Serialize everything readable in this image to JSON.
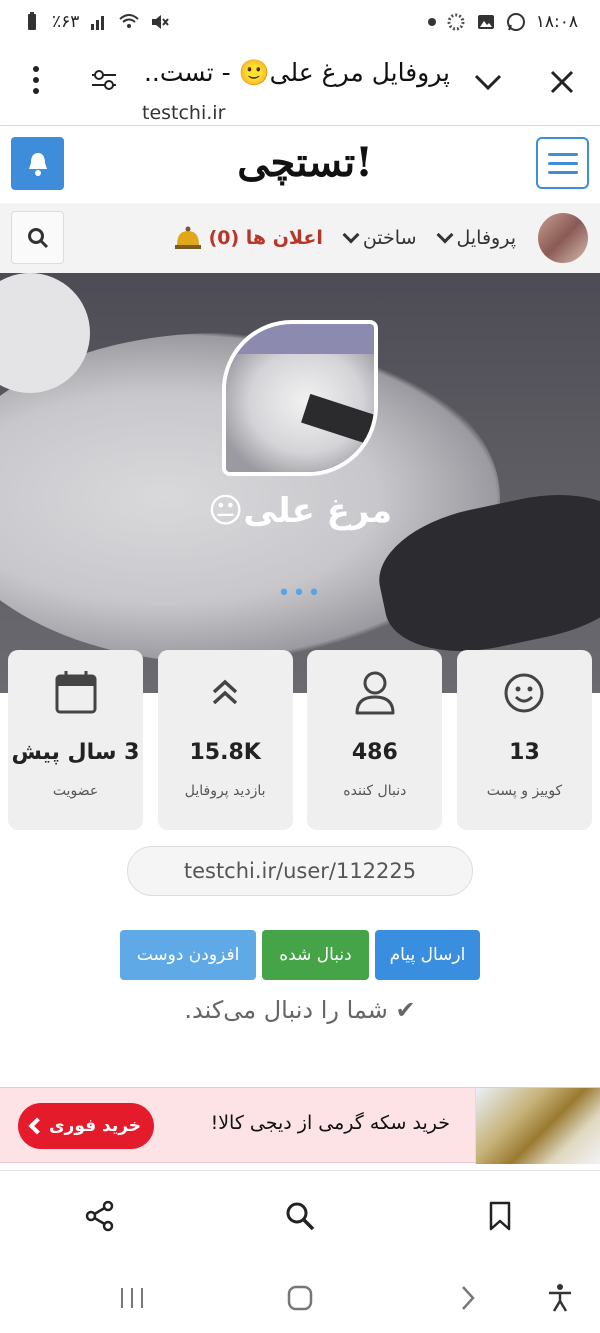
{
  "status_bar": {
    "time": "۱۸:۰۸",
    "battery": "٪۶۳"
  },
  "browser": {
    "tab_title": "پروفایل مرغ علی🙂 - تست..",
    "url": "testchi.ir"
  },
  "site": {
    "logo_text": "تستچی!"
  },
  "nav": {
    "profile_label": "پروفایل",
    "build_label": "ساختن",
    "notifications_label": "اعلان ها (0)"
  },
  "profile": {
    "name": "مرغ علی😐",
    "more": "•••"
  },
  "stats": [
    {
      "value": "13",
      "label": "کوییز و پست",
      "icon": "smiley-icon"
    },
    {
      "value": "486",
      "label": "دنبال کننده",
      "icon": "user-icon"
    },
    {
      "value": "15.8K",
      "label": "بازدید پروفایل",
      "icon": "double-chevron-up-icon"
    },
    {
      "value": "3 سال پیش",
      "label": "عضویت",
      "icon": "calendar-icon"
    }
  ],
  "profile_url": "testchi.ir/user/112225",
  "actions": {
    "send_message": "ارسال پیام",
    "following": "دنبال شده",
    "add_friend": "افزودن دوست"
  },
  "follows_you": "✔ شما را دنبال می‌کند.",
  "ad": {
    "text": "خرید سکه گرمی از دیجی کالا!",
    "button": "خرید فوری"
  },
  "colors": {
    "primary_blue": "#3d8ddb",
    "follow_green": "#44a447",
    "ad_red": "#e41b2b",
    "alert_red": "#b8352a"
  }
}
